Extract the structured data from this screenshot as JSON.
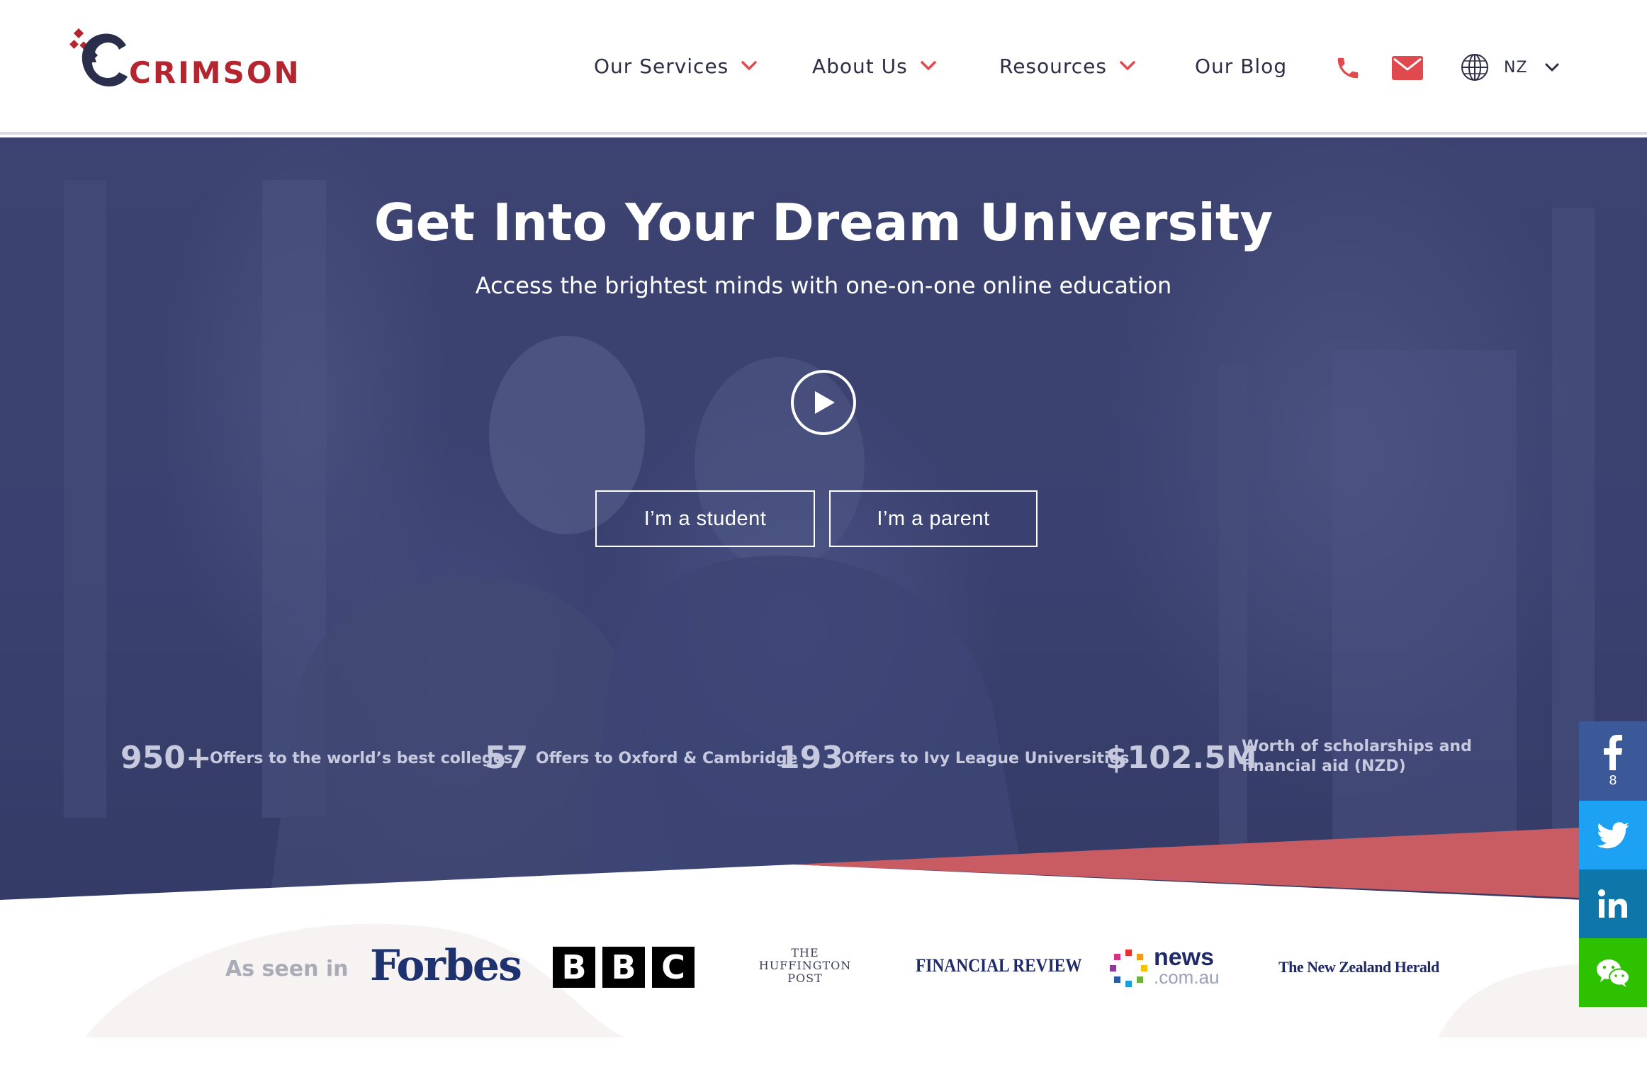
{
  "brand": {
    "name": "CRIMSON",
    "primary_color": "#b3252f",
    "navy": "#2b2e4a",
    "accent_red": "#e04a4f"
  },
  "header": {
    "nav": [
      {
        "label": "Our Services",
        "has_dropdown": true
      },
      {
        "label": "About Us",
        "has_dropdown": true
      },
      {
        "label": "Resources",
        "has_dropdown": true
      },
      {
        "label": "Our Blog",
        "has_dropdown": false
      }
    ],
    "phone_icon": "phone-icon",
    "email_icon": "mail-icon",
    "language": {
      "icon": "globe-icon",
      "selected": "NZ"
    }
  },
  "hero": {
    "title": "Get Into Your Dream University",
    "subtitle": "Access the brightest minds with one-on-one online education",
    "play_icon": "play-icon",
    "buttons": {
      "student": "I’m a student",
      "parent": "I’m a parent"
    },
    "stats": [
      {
        "value": "950+",
        "label": "Offers to the world’s best colleges"
      },
      {
        "value": "57",
        "label": "Offers to Oxford & Cambridge"
      },
      {
        "value": "193",
        "label": "Offers to Ivy League Universities"
      },
      {
        "value": "$102.5M",
        "label": "Worth of scholarships and financial aid (NZD)"
      }
    ]
  },
  "press": {
    "label": "As seen in",
    "logos": {
      "forbes": "Forbes",
      "bbc": [
        "B",
        "B",
        "C"
      ],
      "huffington": [
        "THE",
        "HUFFINGTON",
        "POST"
      ],
      "afr": "FINANCIAL REVIEW",
      "news_main": "news",
      "news_sub": ".com.au",
      "nzherald": "The New Zealand Herald"
    }
  },
  "social": {
    "facebook": {
      "icon": "facebook-icon",
      "count": "8",
      "color": "#3b5998"
    },
    "twitter": {
      "icon": "twitter-icon",
      "color": "#1da1f2"
    },
    "linkedin": {
      "icon": "linkedin-icon",
      "color": "#0e76a8"
    },
    "wechat": {
      "icon": "wechat-icon",
      "color": "#2dc100"
    }
  }
}
